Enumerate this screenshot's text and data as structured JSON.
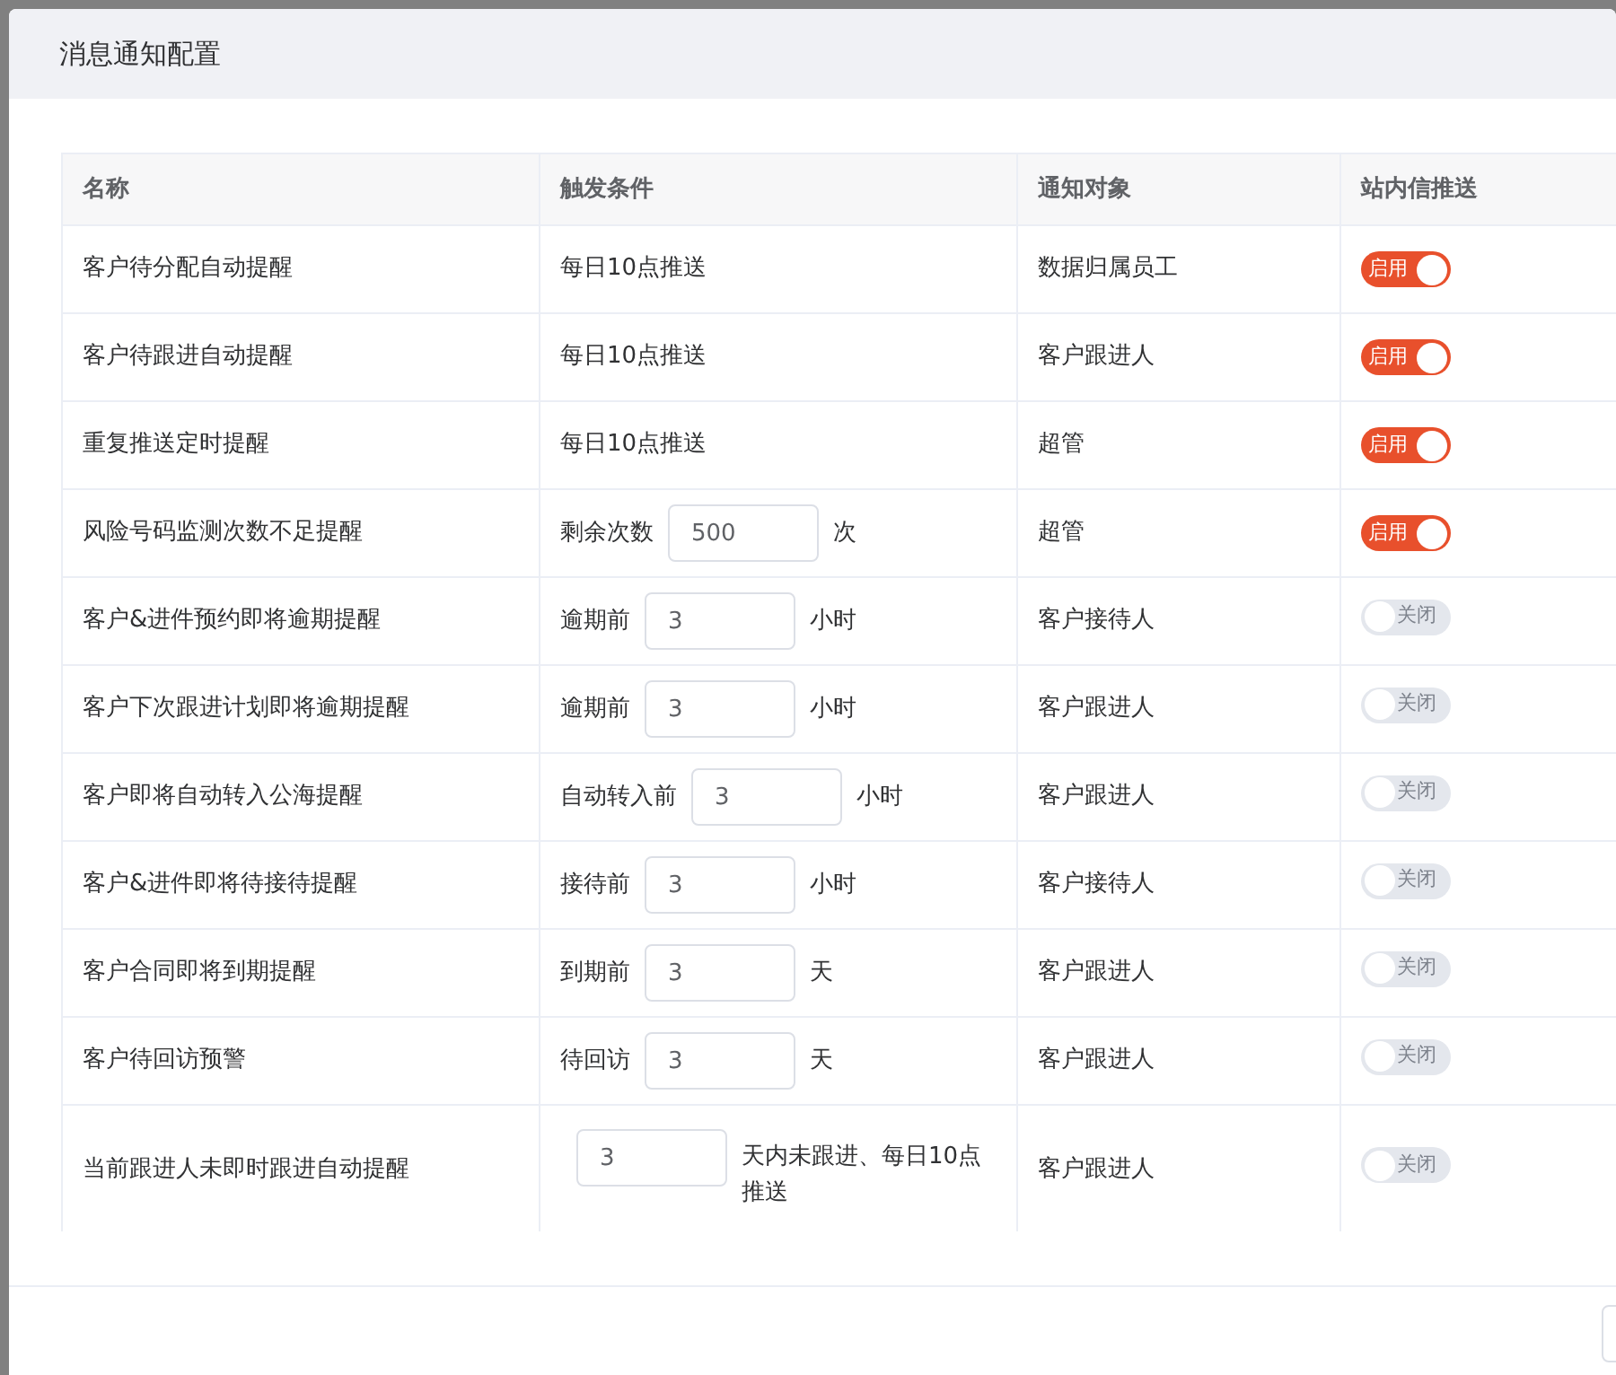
{
  "dialog": {
    "title": "消息通知配置"
  },
  "table": {
    "columns": [
      "名称",
      "触发条件",
      "通知对象",
      "站内信推送"
    ],
    "rows": [
      {
        "name": "客户待分配自动提醒",
        "condition": {
          "kind": "text",
          "text": "每日10点推送"
        },
        "target": "数据归属员工",
        "push": {
          "on": true,
          "label": "启用"
        }
      },
      {
        "name": "客户待跟进自动提醒",
        "condition": {
          "kind": "text",
          "text": "每日10点推送"
        },
        "target": "客户跟进人",
        "push": {
          "on": true,
          "label": "启用"
        }
      },
      {
        "name": "重复推送定时提醒",
        "condition": {
          "kind": "text",
          "text": "每日10点推送"
        },
        "target": "超管",
        "push": {
          "on": true,
          "label": "启用"
        }
      },
      {
        "name": "风险号码监测次数不足提醒",
        "condition": {
          "kind": "input",
          "prefix": "剩余次数",
          "value": "500",
          "suffix": "次"
        },
        "target": "超管",
        "push": {
          "on": true,
          "label": "启用"
        }
      },
      {
        "name": "客户&进件预约即将逾期提醒",
        "condition": {
          "kind": "input",
          "prefix": "逾期前",
          "value": "3",
          "suffix": "小时"
        },
        "target": "客户接待人",
        "push": {
          "on": false,
          "label": "关闭"
        }
      },
      {
        "name": "客户下次跟进计划即将逾期提醒",
        "condition": {
          "kind": "input",
          "prefix": "逾期前",
          "value": "3",
          "suffix": "小时"
        },
        "target": "客户跟进人",
        "push": {
          "on": false,
          "label": "关闭"
        }
      },
      {
        "name": "客户即将自动转入公海提醒",
        "condition": {
          "kind": "input",
          "prefix": "自动转入前",
          "value": "3",
          "suffix": "小时"
        },
        "target": "客户跟进人",
        "push": {
          "on": false,
          "label": "关闭"
        }
      },
      {
        "name": "客户&进件即将待接待提醒",
        "condition": {
          "kind": "input",
          "prefix": "接待前",
          "value": "3",
          "suffix": "小时"
        },
        "target": "客户接待人",
        "push": {
          "on": false,
          "label": "关闭"
        }
      },
      {
        "name": "客户合同即将到期提醒",
        "condition": {
          "kind": "input",
          "prefix": "到期前",
          "value": "3",
          "suffix": "天"
        },
        "target": "客户跟进人",
        "push": {
          "on": false,
          "label": "关闭"
        }
      },
      {
        "name": "客户待回访预警",
        "condition": {
          "kind": "input",
          "prefix": "待回访",
          "value": "3",
          "suffix": "天"
        },
        "target": "客户跟进人",
        "push": {
          "on": false,
          "label": "关闭"
        }
      },
      {
        "name": "当前跟进人未即时跟进自动提醒",
        "condition": {
          "kind": "input",
          "value": "3",
          "suffix": "天内未跟进、每日10点推送"
        },
        "target": "客户跟进人",
        "push": {
          "on": false,
          "label": "关闭"
        }
      }
    ]
  }
}
